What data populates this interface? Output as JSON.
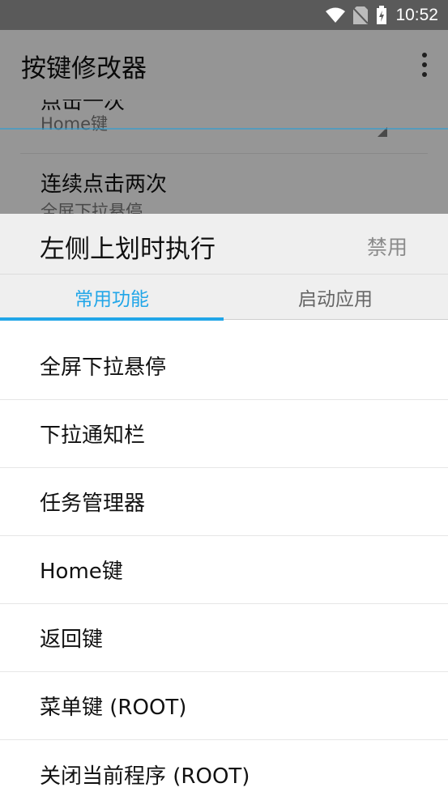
{
  "status_bar": {
    "time": "10:52"
  },
  "app_bar": {
    "title": "按键修改器"
  },
  "background_list": {
    "items": [
      {
        "title": "点击一次",
        "subtitle": "Home键"
      },
      {
        "title": "连续点击两次",
        "subtitle": "全屏下拉悬停"
      }
    ]
  },
  "sheet": {
    "title": "左侧上划时执行",
    "disable_label": "禁用",
    "tabs": [
      {
        "label": "常用功能",
        "active": true
      },
      {
        "label": "启动应用",
        "active": false
      }
    ],
    "items": [
      "全屏下拉悬停",
      "下拉通知栏",
      "任务管理器",
      "Home键",
      "返回键",
      "菜单键 (ROOT)",
      "关闭当前程序 (ROOT)"
    ]
  },
  "colors": {
    "accent": "#21a6e8"
  }
}
